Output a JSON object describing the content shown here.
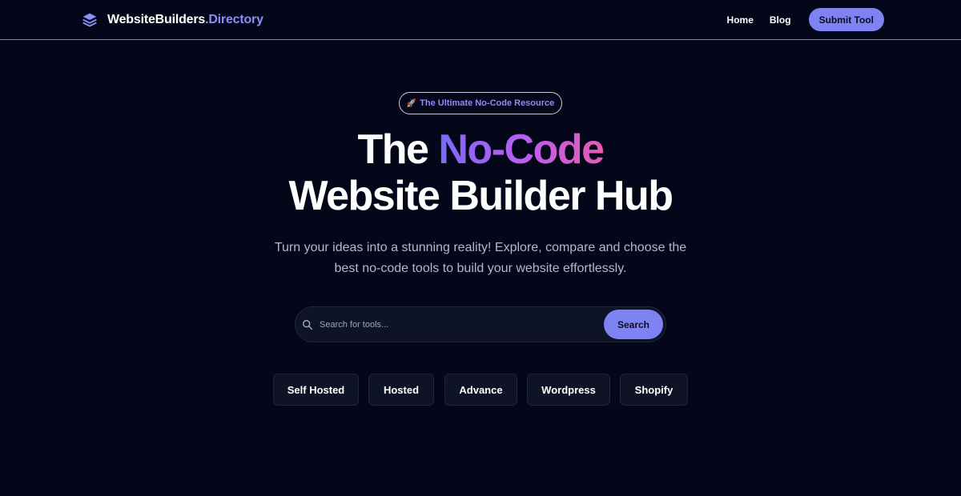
{
  "nav": {
    "brand": {
      "name": "WebsiteBuilders",
      "dot": ".",
      "suffix": "Directory",
      "icon": "layers-icon"
    },
    "links": [
      {
        "label": "Home"
      },
      {
        "label": "Blog"
      }
    ],
    "submit_label": "Submit Tool"
  },
  "hero": {
    "badge": {
      "emoji": "🚀",
      "text": "The Ultimate No-Code Resource"
    },
    "title": {
      "prefix": "The ",
      "highlight": "No-Code",
      "line2": "Website Builder Hub"
    },
    "subtitle_line1": "Turn your ideas into a stunning reality! Explore, compare and choose the",
    "subtitle_line2": "best no-code tools to build your website effortlessly.",
    "search": {
      "placeholder": "Search for tools...",
      "value": "",
      "button": "Search"
    },
    "categories": [
      {
        "label": "Self Hosted"
      },
      {
        "label": "Hosted"
      },
      {
        "label": "Advance"
      },
      {
        "label": "Wordpress"
      },
      {
        "label": "Shopify"
      }
    ]
  },
  "colors": {
    "background": "#04061a",
    "accent": "#7f83f2",
    "brand_accent": "#8b8ef7",
    "gradient_start": "#7a6af6",
    "gradient_end": "#e75cb2"
  }
}
